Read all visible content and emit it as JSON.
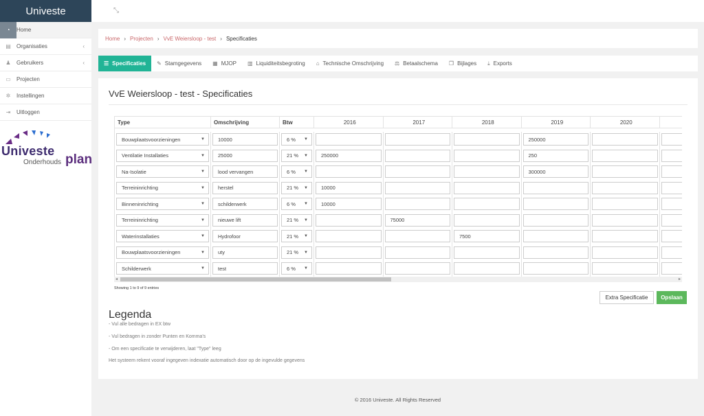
{
  "app": {
    "title": "Univeste"
  },
  "sidebar": {
    "items": [
      {
        "label": "Home",
        "icon": "dashboard-icon",
        "active": true
      },
      {
        "label": "Organisaties",
        "icon": "building-icon",
        "chevron": "‹"
      },
      {
        "label": "Gebruikers",
        "icon": "users-icon",
        "chevron": "‹"
      },
      {
        "label": "Projecten",
        "icon": "file-icon"
      },
      {
        "label": "Instellingen",
        "icon": "gear-icon"
      },
      {
        "label": "Uitloggen",
        "icon": "logout-icon"
      }
    ],
    "logo": {
      "word": "Univeste",
      "sub": "Onderhouds",
      "plan": "plan"
    }
  },
  "breadcrumb": {
    "items": [
      "Home",
      "Projecten",
      "VvE Weiersloop - test"
    ],
    "current": "Specificaties",
    "sep": "›"
  },
  "tabs": [
    {
      "label": "Specificaties",
      "icon": "list-icon",
      "active": true
    },
    {
      "label": "Stamgegevens",
      "icon": "pencil-icon"
    },
    {
      "label": "MJOP",
      "icon": "calendar-icon"
    },
    {
      "label": "Liquiditeitsbegroting",
      "icon": "bar-chart-icon"
    },
    {
      "label": "Technische Omschrijving",
      "icon": "bank-icon"
    },
    {
      "label": "Betaalschema",
      "icon": "scale-icon"
    },
    {
      "label": "Bijlages",
      "icon": "copy-icon"
    },
    {
      "label": "Exports",
      "icon": "download-icon"
    }
  ],
  "page": {
    "title": "VvE Weiersloop - test - Specificaties"
  },
  "table": {
    "headers": {
      "type": "Type",
      "omschrijving": "Omschrijving",
      "btw": "Btw"
    },
    "years": [
      "2016",
      "2017",
      "2018",
      "2019",
      "2020"
    ],
    "rows": [
      {
        "type": "Bouwplaatsvoorzieningen",
        "omschrijving": "10000",
        "btw": "6 %",
        "values": [
          "",
          "",
          "",
          "250000",
          "",
          ""
        ]
      },
      {
        "type": "Ventilatie Installaties",
        "omschrijving": "25000",
        "btw": "21 %",
        "values": [
          "250000",
          "",
          "",
          "250",
          "",
          ""
        ]
      },
      {
        "type": "Na-Isolatie",
        "omschrijving": "lood vervangen",
        "btw": "6 %",
        "values": [
          "",
          "",
          "",
          "300000",
          "",
          ""
        ]
      },
      {
        "type": "Terreininrichting",
        "omschrijving": "herstel",
        "btw": "21 %",
        "values": [
          "10000",
          "",
          "",
          "",
          "",
          ""
        ]
      },
      {
        "type": "Binneninrichting",
        "omschrijving": "schilderwerk",
        "btw": "6 %",
        "values": [
          "10000",
          "",
          "",
          "",
          "",
          ""
        ]
      },
      {
        "type": "Terreininrichting",
        "omschrijving": "nieuwe lift",
        "btw": "21 %",
        "values": [
          "",
          "75000",
          "",
          "",
          "",
          ""
        ]
      },
      {
        "type": "Waterinstallaties",
        "omschrijving": "Hydrofoor",
        "btw": "21 %",
        "values": [
          "",
          "",
          "7500",
          "",
          "",
          ""
        ]
      },
      {
        "type": "Bouwplaatsvoorzieningen",
        "omschrijving": "uty",
        "btw": "21 %",
        "values": [
          "",
          "",
          "",
          "",
          "",
          ""
        ]
      },
      {
        "type": "Schilderwerk",
        "omschrijving": "test",
        "btw": "6 %",
        "values": [
          "",
          "",
          "",
          "",
          "",
          ""
        ]
      }
    ],
    "entries_text": "Showing 1 to 9 of 9 entries"
  },
  "buttons": {
    "extra": "Extra Specificatie",
    "save": "Opslaan"
  },
  "legend": {
    "title": "Legenda",
    "lines": [
      "- Vul alle bedragen in EX btw",
      "- Vul bedragen in zonder Punten en Komma's",
      "- Om een specificatie te verwijderen, laat \"Type\" leeg",
      "Het systeem rekent vooraf ingegeven indexatie automatisch door op de ingevulde gegevens"
    ]
  },
  "footer": {
    "text": "© 2016 Univeste. All Rights Reserved"
  },
  "colors": {
    "brand_dark": "#2d4559",
    "accent_tab": "#21b496",
    "save_green": "#5cb85c",
    "crumb_link": "#c9676a"
  }
}
